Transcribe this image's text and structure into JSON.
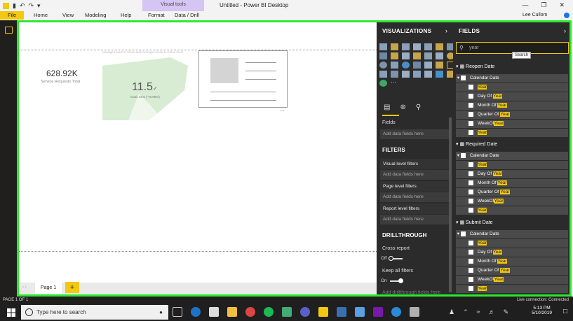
{
  "titlebar": {
    "quick_access": [
      "▮",
      "↶",
      "↷",
      "▾"
    ],
    "context_tab": "Visual tools",
    "window_title": "Untitled - Power BI Desktop",
    "controls": [
      "—",
      "❐",
      "✕"
    ]
  },
  "menu": {
    "file": "File",
    "items": [
      "Home",
      "View",
      "Modeling",
      "Help",
      "Format",
      "Data / Drill"
    ],
    "user": "Lee Cullom"
  },
  "canvas": {
    "kpi_value": "628.92K",
    "kpi_label": "Service Requests Total",
    "gauge_title": "Average Hours to Close and Average Hours to Close Goal",
    "gauge_value": "11.5",
    "gauge_unit": "✓",
    "gauge_goal": "Goal: 48.6 (-76.06%)",
    "more": "…"
  },
  "pages": {
    "tab": "Page 1",
    "add": "+"
  },
  "visualizations": {
    "header": "VISUALIZATIONS",
    "fields_label": "Fields",
    "add_data": "Add data fields here",
    "filters_header": "FILTERS",
    "visual_filters": "Visual level filters",
    "page_filters": "Page level filters",
    "report_filters": "Report level filters",
    "drill_header": "DRILLTHROUGH",
    "cross_report": "Cross-report",
    "cross_report_state": "Off",
    "keep_filters": "Keep all filters",
    "keep_filters_state": "On",
    "cutoff": "Add drillthrough fields here"
  },
  "fields": {
    "header": "FIELDS",
    "search_value": "year",
    "tooltip": "Search",
    "groups": [
      {
        "table": "Reopen Date",
        "hierarchy": "Calendar Date"
      },
      {
        "table": "Required Date",
        "hierarchy": "Calendar Date"
      },
      {
        "table": "Submit Date",
        "hierarchy": "Calendar Date"
      }
    ],
    "rows": [
      {
        "pre": "",
        "hl": "Year"
      },
      {
        "pre": "Day Of ",
        "hl": "Year"
      },
      {
        "pre": "Month Of ",
        "hl": "Year"
      },
      {
        "pre": "Quarter Of ",
        "hl": "Year"
      },
      {
        "pre": "WeekOf",
        "hl": "Year"
      },
      {
        "pre": "",
        "hl": "Year"
      }
    ]
  },
  "status": {
    "page": "PAGE 1 OF 1",
    "connection": "Live connection: Connected"
  },
  "taskbar": {
    "search_placeholder": "Type here to search",
    "time": "5:13 PM",
    "date": "5/10/2019"
  },
  "colors": {
    "accent": "#f2c811",
    "frame": "#2ee82e",
    "pane": "#2b2b2b"
  }
}
